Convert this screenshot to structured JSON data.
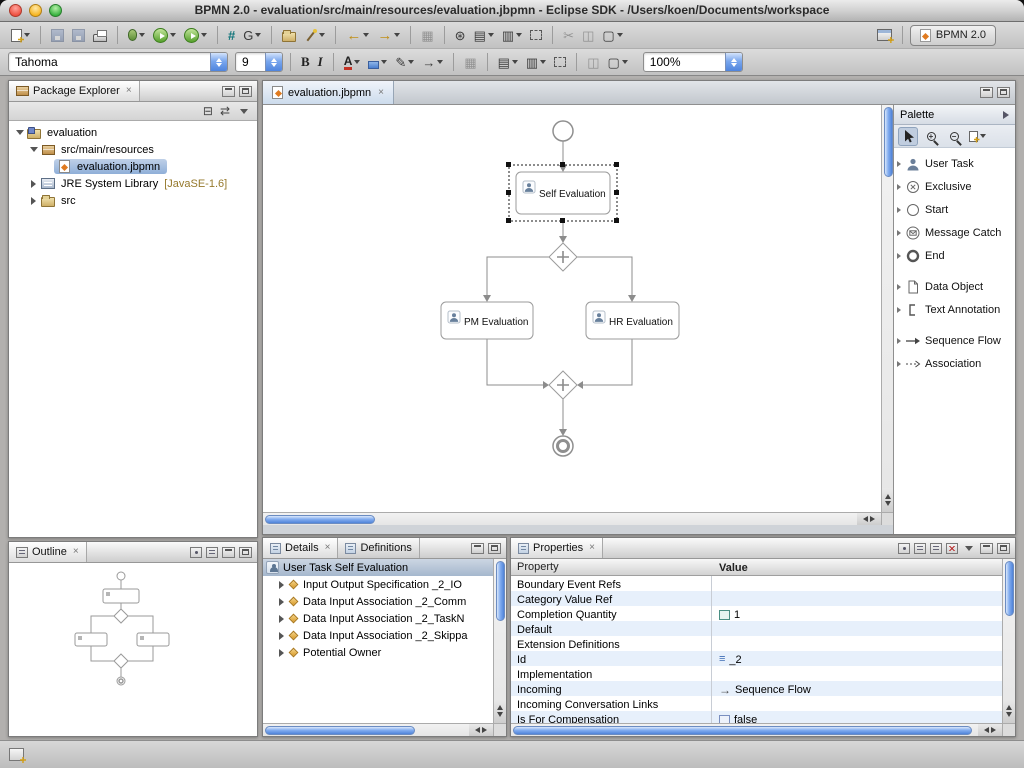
{
  "window": {
    "title": "BPMN 2.0 - evaluation/src/main/resources/evaluation.jbpmn - Eclipse SDK - /Users/koen/Documents/workspace"
  },
  "icons": {
    "grid": "#",
    "g": "G",
    "back": "←",
    "forward": "→",
    "table": "▦",
    "radial": "⊛",
    "layout_a": "▤",
    "layout_b": "▥",
    "cut": "✂",
    "panes": "◫",
    "shape": "▢",
    "pencil": "✎",
    "collapse_all": "⊟",
    "link": "⇄",
    "id": "≡",
    "flow_arrow": "→"
  },
  "format_bar": {
    "font": "Tahoma",
    "size": "9",
    "bold": "B",
    "italic": "I",
    "font_color": "A",
    "arrow": "→",
    "zoom": "100%"
  },
  "perspective": {
    "label": "BPMN 2.0"
  },
  "package_explorer": {
    "title": "Package Explorer",
    "project": "evaluation",
    "resources": "src/main/resources",
    "file": "evaluation.jbpmn",
    "jre": "JRE System Library",
    "jre_version": "[JavaSE-1.6]",
    "src": "src"
  },
  "editor": {
    "tab": "evaluation.jbpmn",
    "diagram": {
      "self": "Self Evaluation",
      "pm": "PM Evaluation",
      "hr": "HR Evaluation"
    }
  },
  "palette": {
    "title": "Palette",
    "items": [
      {
        "label": "User Task"
      },
      {
        "label": "Exclusive"
      },
      {
        "label": "Start"
      },
      {
        "label": "Message Catch"
      },
      {
        "label": "End"
      },
      {
        "label": "Data Object"
      },
      {
        "label": "Text Annotation"
      },
      {
        "label": "Sequence Flow"
      },
      {
        "label": "Association"
      }
    ]
  },
  "outline": {
    "title": "Outline"
  },
  "details": {
    "tab_details": "Details",
    "tab_definitions": "Definitions",
    "root": "User Task Self Evaluation",
    "children": [
      {
        "label": "Input Output Specification _2_IO"
      },
      {
        "label": "Data Input Association _2_Comm"
      },
      {
        "label": "Data Input Association _2_TaskN"
      },
      {
        "label": "Data Input Association _2_Skippa"
      },
      {
        "label": "Potential Owner"
      }
    ]
  },
  "properties": {
    "title": "Properties",
    "columns": {
      "property": "Property",
      "value": "Value"
    },
    "rows": [
      {
        "property": "Boundary Event Refs",
        "value": ""
      },
      {
        "property": "Category Value Ref",
        "value": ""
      },
      {
        "property": "Completion Quantity",
        "value": "1"
      },
      {
        "property": "Default",
        "value": ""
      },
      {
        "property": "Extension Definitions",
        "value": ""
      },
      {
        "property": "Id",
        "value": "_2"
      },
      {
        "property": "Implementation",
        "value": ""
      },
      {
        "property": "Incoming",
        "value": "Sequence Flow"
      },
      {
        "property": "Incoming Conversation Links",
        "value": ""
      },
      {
        "property": "Is For Compensation",
        "value": "false"
      }
    ]
  }
}
